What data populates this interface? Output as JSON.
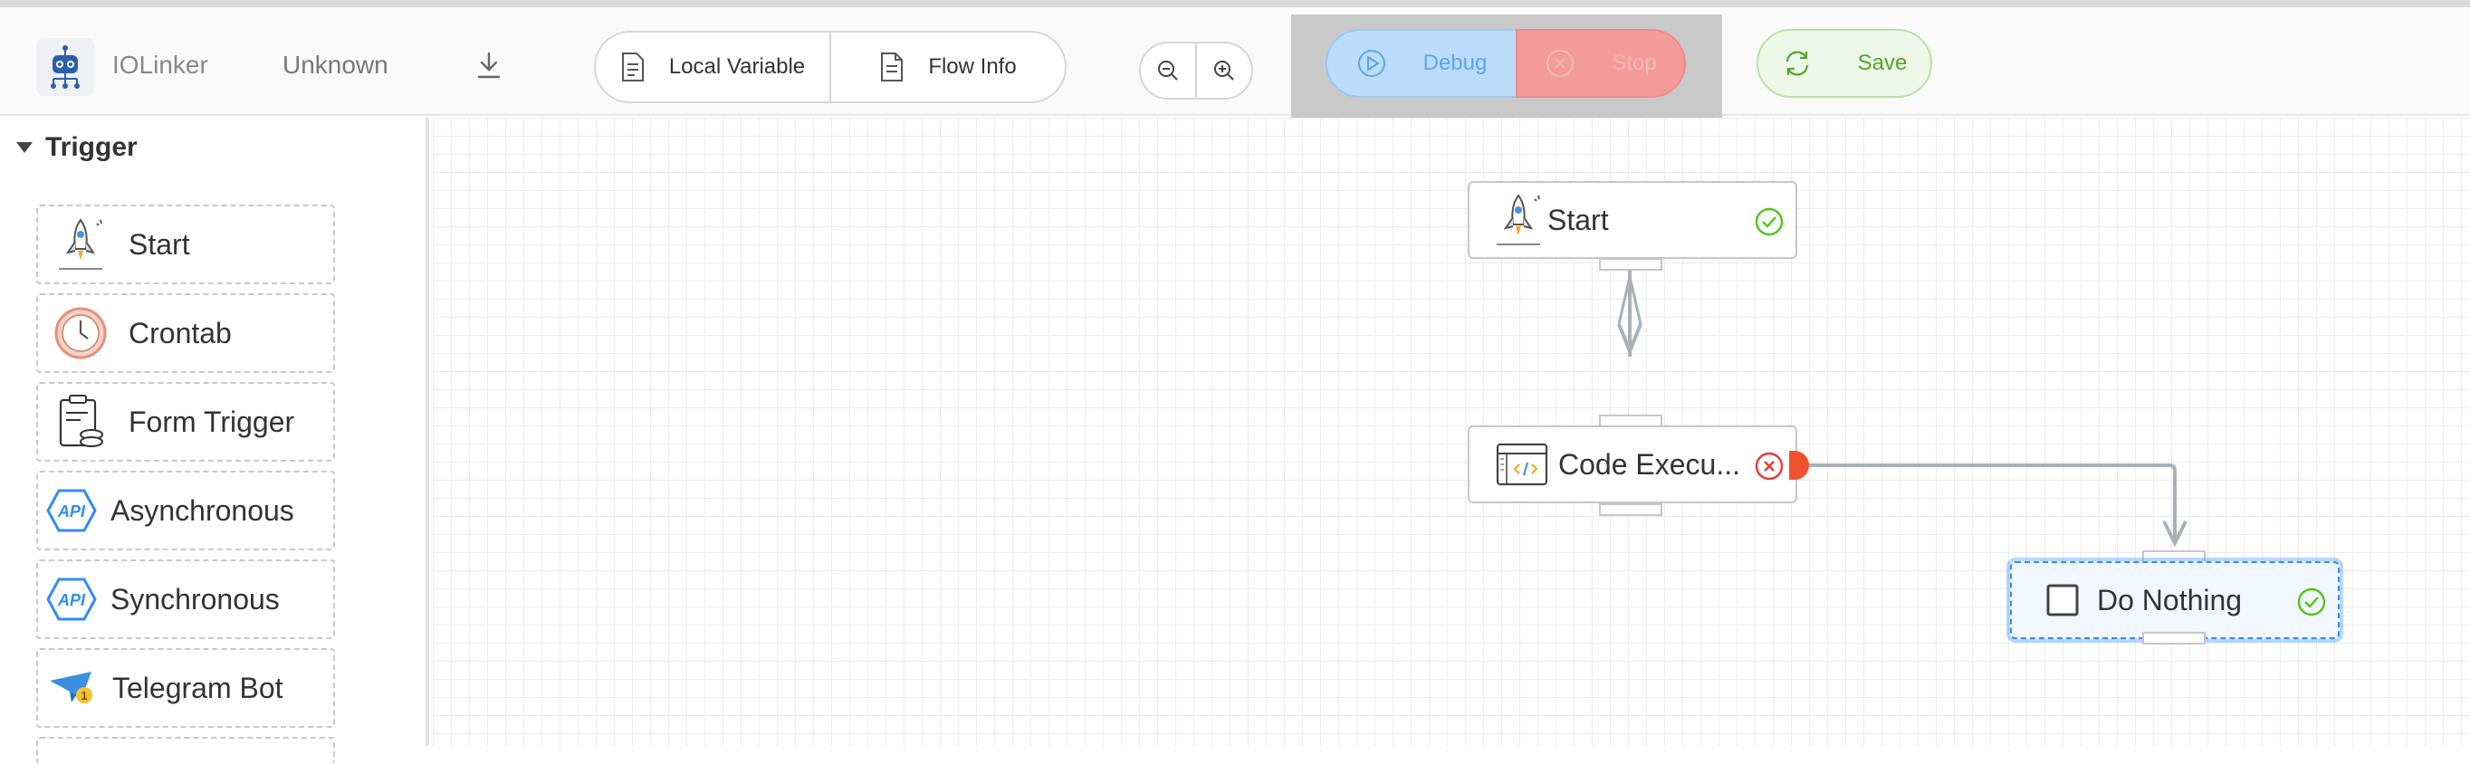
{
  "header": {
    "app_name": "IOLinker",
    "flow_name": "Unknown",
    "local_variable_label": "Local Variable",
    "flow_info_label": "Flow Info",
    "debug_label": "Debug",
    "stop_label": "Stop",
    "save_label": "Save"
  },
  "sidebar": {
    "section_title": "Trigger",
    "items": [
      {
        "label": "Start",
        "icon": "rocket-icon"
      },
      {
        "label": "Crontab",
        "icon": "clock-icon"
      },
      {
        "label": "Form Trigger",
        "icon": "form-icon"
      },
      {
        "label": "Asynchronous",
        "icon": "api-icon"
      },
      {
        "label": "Synchronous",
        "icon": "api-icon"
      },
      {
        "label": "Telegram Bot",
        "icon": "telegram-icon"
      }
    ]
  },
  "canvas": {
    "nodes": [
      {
        "label": "Start",
        "status": "success"
      },
      {
        "label": "Code Execu...",
        "status": "error"
      },
      {
        "label": "Do Nothing",
        "status": "success",
        "selected": true
      }
    ]
  },
  "colors": {
    "debug_bg": "#bcdcfb",
    "stop_bg": "#f59a9a",
    "save_fg": "#53a52d",
    "success": "#52c41a",
    "error": "#e53935",
    "selection": "#2f8cf5"
  }
}
